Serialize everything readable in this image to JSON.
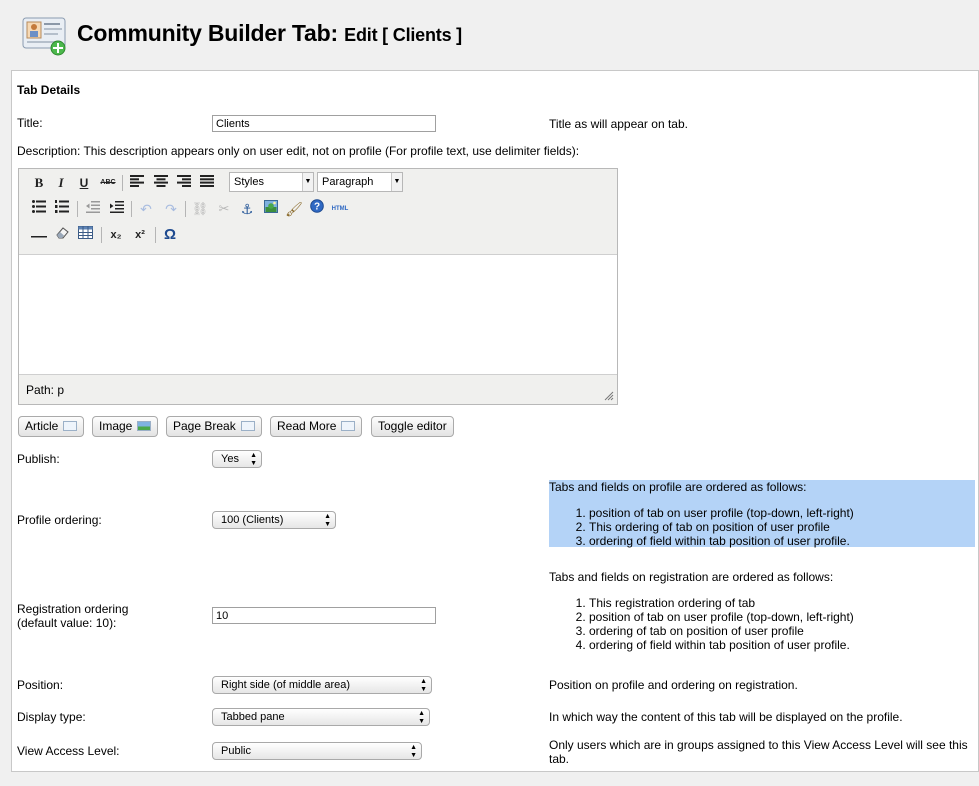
{
  "header": {
    "title": "Community Builder Tab:",
    "subtitle": "Edit [ Clients ]"
  },
  "section_title": "Tab Details",
  "title_field": {
    "label": "Title:",
    "value": "Clients",
    "help": "Title as will appear on tab."
  },
  "description": {
    "label": "Description: This description appears only on user edit, not on profile (For profile text, use delimiter fields):"
  },
  "editor": {
    "styles_select": "Styles",
    "format_select": "Paragraph",
    "path_label": "Path: p",
    "toolbar_icons": [
      "bold-icon",
      "italic-icon",
      "underline-icon",
      "strikethrough-icon",
      "align-left-icon",
      "align-center-icon",
      "align-right-icon",
      "align-justify-icon",
      "bullet-list-icon",
      "numbered-list-icon",
      "outdent-icon",
      "indent-icon",
      "undo-icon",
      "redo-icon",
      "link-icon",
      "unlink-icon",
      "anchor-icon",
      "image-icon",
      "cleanup-icon",
      "help-icon",
      "html-icon",
      "horizontal-rule-icon",
      "remove-format-icon",
      "table-icon",
      "subscript-icon",
      "superscript-icon",
      "special-char-icon"
    ],
    "bold": "B",
    "italic": "I",
    "underline": "U",
    "strike": "ABC",
    "html": "HTML",
    "sub": "x₂",
    "sup": "x²",
    "omega": "Ω"
  },
  "editor_buttons": {
    "article": "Article",
    "image": "Image",
    "page_break": "Page Break",
    "read_more": "Read More",
    "toggle_editor": "Toggle editor"
  },
  "publish": {
    "label": "Publish:",
    "value": "Yes"
  },
  "profile_ordering": {
    "label": "Profile ordering:",
    "value": "100 (Clients)",
    "help_title": "Tabs and fields on profile are ordered as follows:",
    "help_items": [
      "position of tab on user profile (top-down, left-right)",
      "This ordering of tab on position of user profile",
      "ordering of field within tab position of user profile."
    ]
  },
  "registration_ordering": {
    "label_line1": "Registration ordering",
    "label_line2": "(default value: 10):",
    "value": "10",
    "help_title": "Tabs and fields on registration are ordered as follows:",
    "help_items": [
      "This registration ordering of tab",
      "position of tab on user profile (top-down, left-right)",
      "ordering of tab on position of user profile",
      "ordering of field within tab position of user profile."
    ]
  },
  "position": {
    "label": "Position:",
    "value": "Right side (of middle area)",
    "help": "Position on profile and ordering on registration."
  },
  "display_type": {
    "label": "Display type:",
    "value": "Tabbed pane",
    "help": "In which way the content of this tab will be displayed on the profile."
  },
  "view_access": {
    "label": "View Access Level:",
    "value": "Public",
    "help": "Only users which are in groups assigned to this View Access Level will see this tab."
  }
}
